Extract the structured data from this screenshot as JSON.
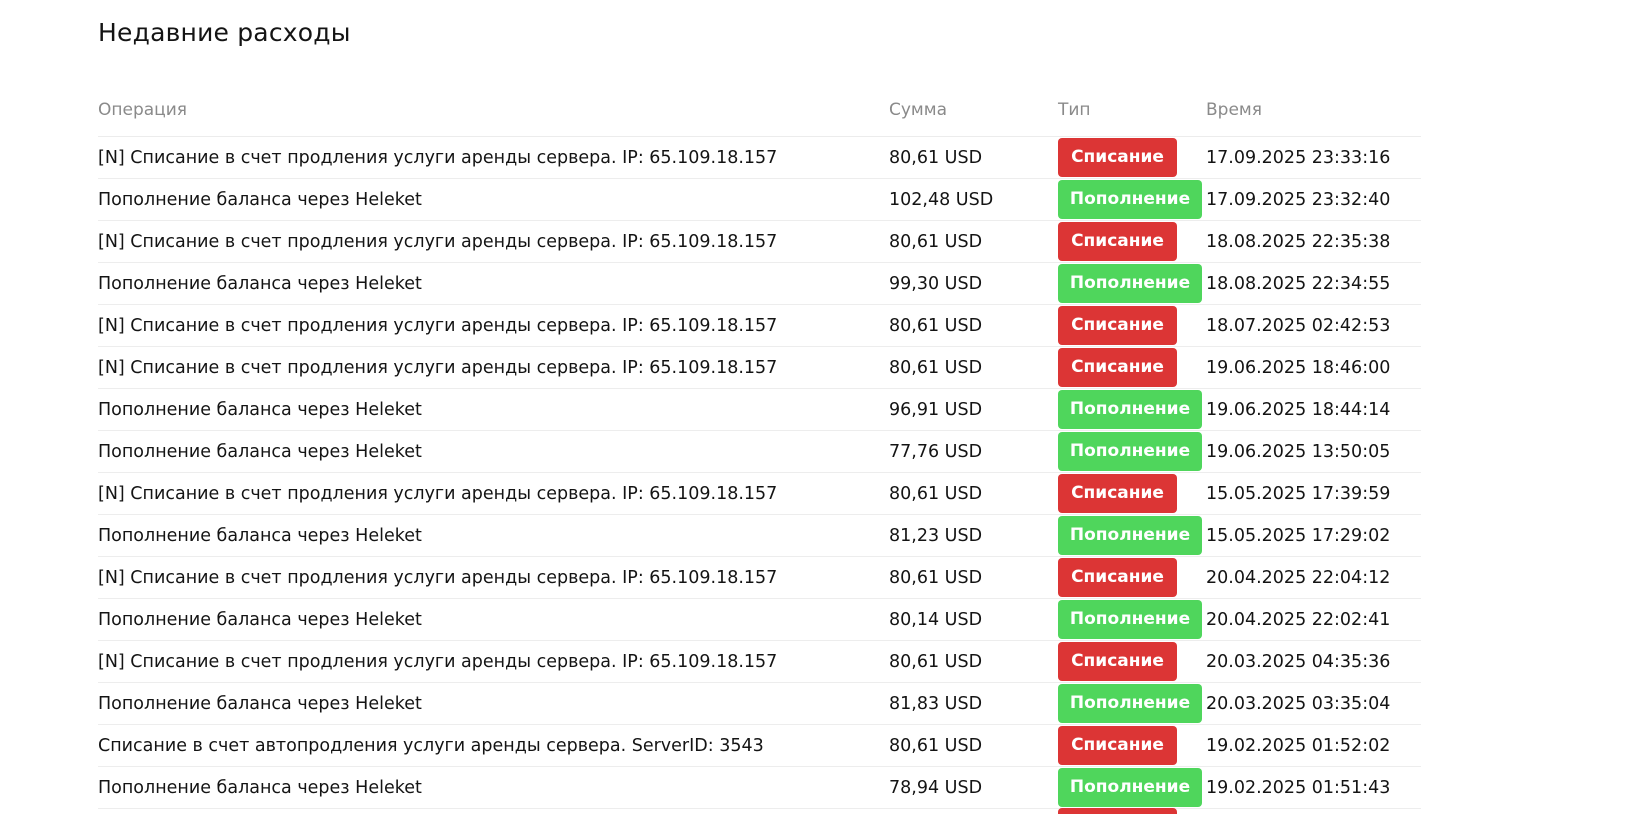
{
  "title": "Недавние расходы",
  "columns": {
    "operation": "Операция",
    "amount": "Сумма",
    "type": "Тип",
    "time": "Время"
  },
  "colors": {
    "debit": "#dc3535",
    "credit": "#4fd65c"
  },
  "rows": [
    {
      "operation": "[N] Списание в счет продления услуги аренды сервера. IP: 65.109.18.157",
      "amount": "80,61 USD",
      "type": "Списание",
      "kind": "debit",
      "time": "17.09.2025 23:33:16"
    },
    {
      "operation": "Пополнение баланса через Heleket",
      "amount": "102,48 USD",
      "type": "Пополнение",
      "kind": "credit",
      "time": "17.09.2025 23:32:40"
    },
    {
      "operation": "[N] Списание в счет продления услуги аренды сервера. IP: 65.109.18.157",
      "amount": "80,61 USD",
      "type": "Списание",
      "kind": "debit",
      "time": "18.08.2025 22:35:38"
    },
    {
      "operation": "Пополнение баланса через Heleket",
      "amount": "99,30 USD",
      "type": "Пополнение",
      "kind": "credit",
      "time": "18.08.2025 22:34:55"
    },
    {
      "operation": "[N] Списание в счет продления услуги аренды сервера. IP: 65.109.18.157",
      "amount": "80,61 USD",
      "type": "Списание",
      "kind": "debit",
      "time": "18.07.2025 02:42:53"
    },
    {
      "operation": "[N] Списание в счет продления услуги аренды сервера. IP: 65.109.18.157",
      "amount": "80,61 USD",
      "type": "Списание",
      "kind": "debit",
      "time": "19.06.2025 18:46:00"
    },
    {
      "operation": "Пополнение баланса через Heleket",
      "amount": "96,91 USD",
      "type": "Пополнение",
      "kind": "credit",
      "time": "19.06.2025 18:44:14"
    },
    {
      "operation": "Пополнение баланса через Heleket",
      "amount": "77,76 USD",
      "type": "Пополнение",
      "kind": "credit",
      "time": "19.06.2025 13:50:05"
    },
    {
      "operation": "[N] Списание в счет продления услуги аренды сервера. IP: 65.109.18.157",
      "amount": "80,61 USD",
      "type": "Списание",
      "kind": "debit",
      "time": "15.05.2025 17:39:59"
    },
    {
      "operation": "Пополнение баланса через Heleket",
      "amount": "81,23 USD",
      "type": "Пополнение",
      "kind": "credit",
      "time": "15.05.2025 17:29:02"
    },
    {
      "operation": "[N] Списание в счет продления услуги аренды сервера. IP: 65.109.18.157",
      "amount": "80,61 USD",
      "type": "Списание",
      "kind": "debit",
      "time": "20.04.2025 22:04:12"
    },
    {
      "operation": "Пополнение баланса через Heleket",
      "amount": "80,14 USD",
      "type": "Пополнение",
      "kind": "credit",
      "time": "20.04.2025 22:02:41"
    },
    {
      "operation": "[N] Списание в счет продления услуги аренды сервера. IP: 65.109.18.157",
      "amount": "80,61 USD",
      "type": "Списание",
      "kind": "debit",
      "time": "20.03.2025 04:35:36"
    },
    {
      "operation": "Пополнение баланса через Heleket",
      "amount": "81,83 USD",
      "type": "Пополнение",
      "kind": "credit",
      "time": "20.03.2025 03:35:04"
    },
    {
      "operation": "Списание в счет автопродления услуги аренды сервера. ServerID: 3543",
      "amount": "80,61 USD",
      "type": "Списание",
      "kind": "debit",
      "time": "19.02.2025 01:52:02"
    },
    {
      "operation": "Пополнение баланса через Heleket",
      "amount": "78,94 USD",
      "type": "Пополнение",
      "kind": "credit",
      "time": "19.02.2025 01:51:43"
    },
    {
      "operation": "",
      "amount": "",
      "type": "",
      "kind": "debit",
      "time": ""
    }
  ]
}
